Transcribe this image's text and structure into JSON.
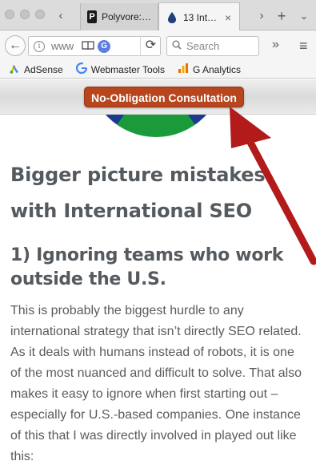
{
  "browser": {
    "tabs": [
      {
        "title": "Polyvore:…",
        "favicon": "P",
        "active": false
      },
      {
        "title": "13 Int…",
        "favicon": "drop-icon",
        "active": true
      }
    ],
    "new_tab_glyph": "+",
    "url_text": "www",
    "search_placeholder": "Search",
    "glyphs": {
      "back": "‹",
      "forward": "›",
      "reload": "C",
      "overflow": "»",
      "menu": "≡",
      "close": "×",
      "tab_list": "⌄",
      "info": "i",
      "g_badge": "G",
      "reader": "📖"
    }
  },
  "bookmarks": [
    {
      "label": "AdSense",
      "icon": "adsense-icon"
    },
    {
      "label": "Webmaster Tools",
      "icon": "google-g-icon"
    },
    {
      "label": "G Analytics",
      "icon": "analytics-icon"
    }
  ],
  "page": {
    "cta_button": "No-Obligation Consultation",
    "heading_main": "Bigger picture mistakes with International SEO",
    "heading_section": "1) Ignoring teams who work outside the U.S.",
    "paragraph": "This is probably the biggest hurdle to any international strategy that isn’t directly SEO related. As it deals with humans instead of robots, it is one of the most nuanced and difficult to solve. That also makes it easy to ignore when first starting out – especially for U.S.-based companies. One instance of this that I was directly involved in played out like this:"
  },
  "colors": {
    "cta_background": "#b7451d",
    "arrow": "#b31b1b",
    "heading_text": "#555a5f",
    "body_text": "#5b5b5b"
  }
}
